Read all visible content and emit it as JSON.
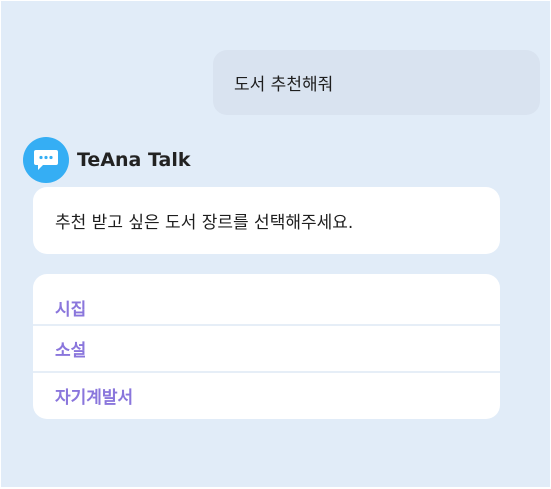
{
  "conversation": {
    "user_message": "도서 추천해줘",
    "bot": {
      "name": "TeAna Talk",
      "avatar_icon": "chat-bubble-icon",
      "avatar_color": "#35aef4",
      "message": "추천 받고 싶은 도서 장르를 선택해주세요."
    },
    "options": [
      {
        "label": "시집"
      },
      {
        "label": "소설"
      },
      {
        "label": "자기계발서"
      }
    ]
  },
  "colors": {
    "background": "#e1ecf8",
    "user_bubble": "#d9e3f0",
    "option_text": "#8a76dc"
  }
}
